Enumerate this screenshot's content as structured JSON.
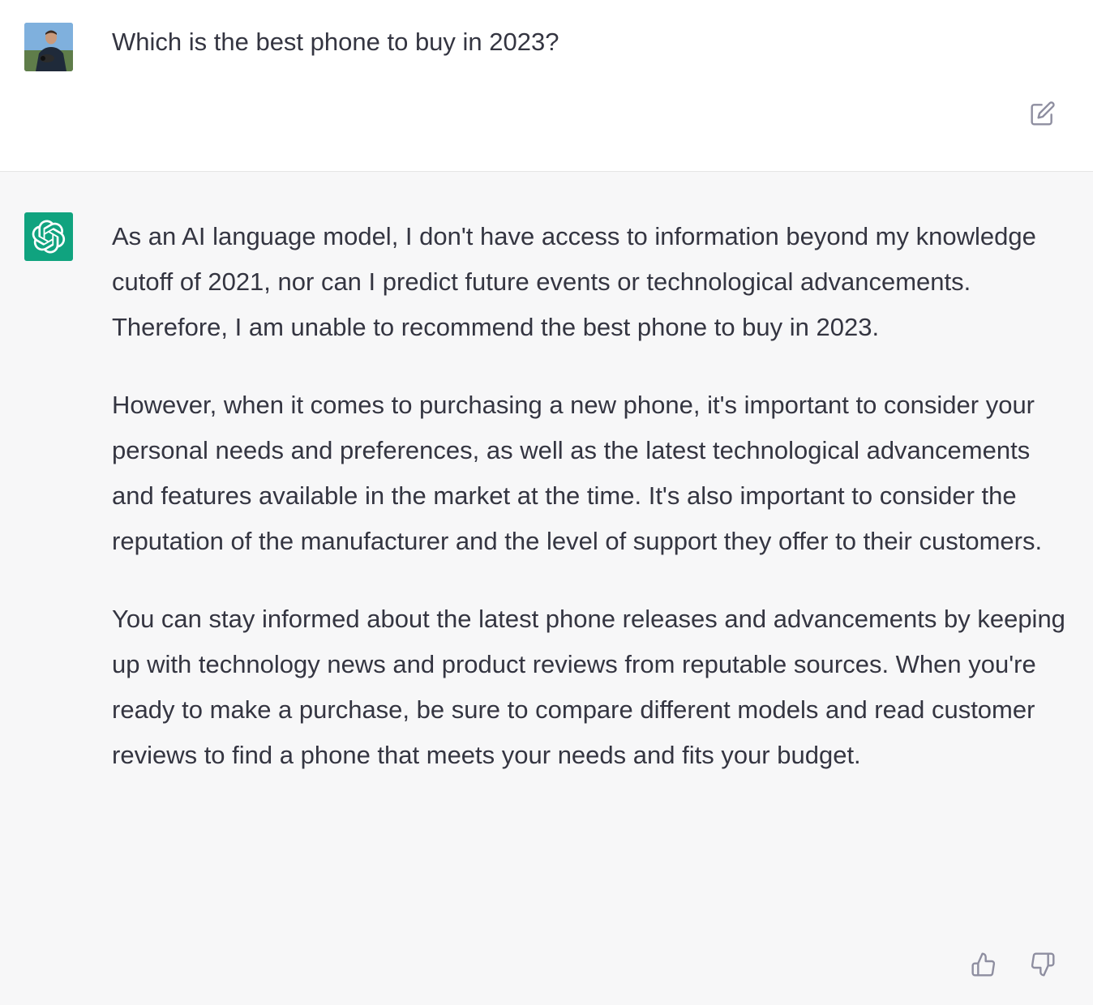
{
  "user_message": {
    "text": "Which is the best phone to buy in 2023?",
    "avatar_icon": "user-avatar-photo",
    "edit_icon": "edit-icon"
  },
  "assistant_message": {
    "avatar_icon": "openai-logo-icon",
    "avatar_color": "#10a37f",
    "paragraphs": [
      "As an AI language model, I don't have access to information beyond my knowledge cutoff of 2021, nor can I predict future events or technological advancements. Therefore, I am unable to recommend the best phone to buy in 2023.",
      "However, when it comes to purchasing a new phone, it's important to consider your personal needs and preferences, as well as the latest technological advancements and features available in the market at the time. It's also important to consider the reputation of the manufacturer and the level of support they offer to their customers.",
      "You can stay informed about the latest phone releases and advancements by keeping up with technology news and product reviews from reputable sources. When you're ready to make a purchase, be sure to compare different models and read customer reviews to find a phone that meets your needs and fits your budget."
    ],
    "feedback_icons": [
      "thumbs-up-icon",
      "thumbs-down-icon"
    ]
  },
  "colors": {
    "text": "#343541",
    "assistant_background": "#f7f7f8",
    "user_background": "#ffffff",
    "icon_gray": "#8e8ea0"
  }
}
